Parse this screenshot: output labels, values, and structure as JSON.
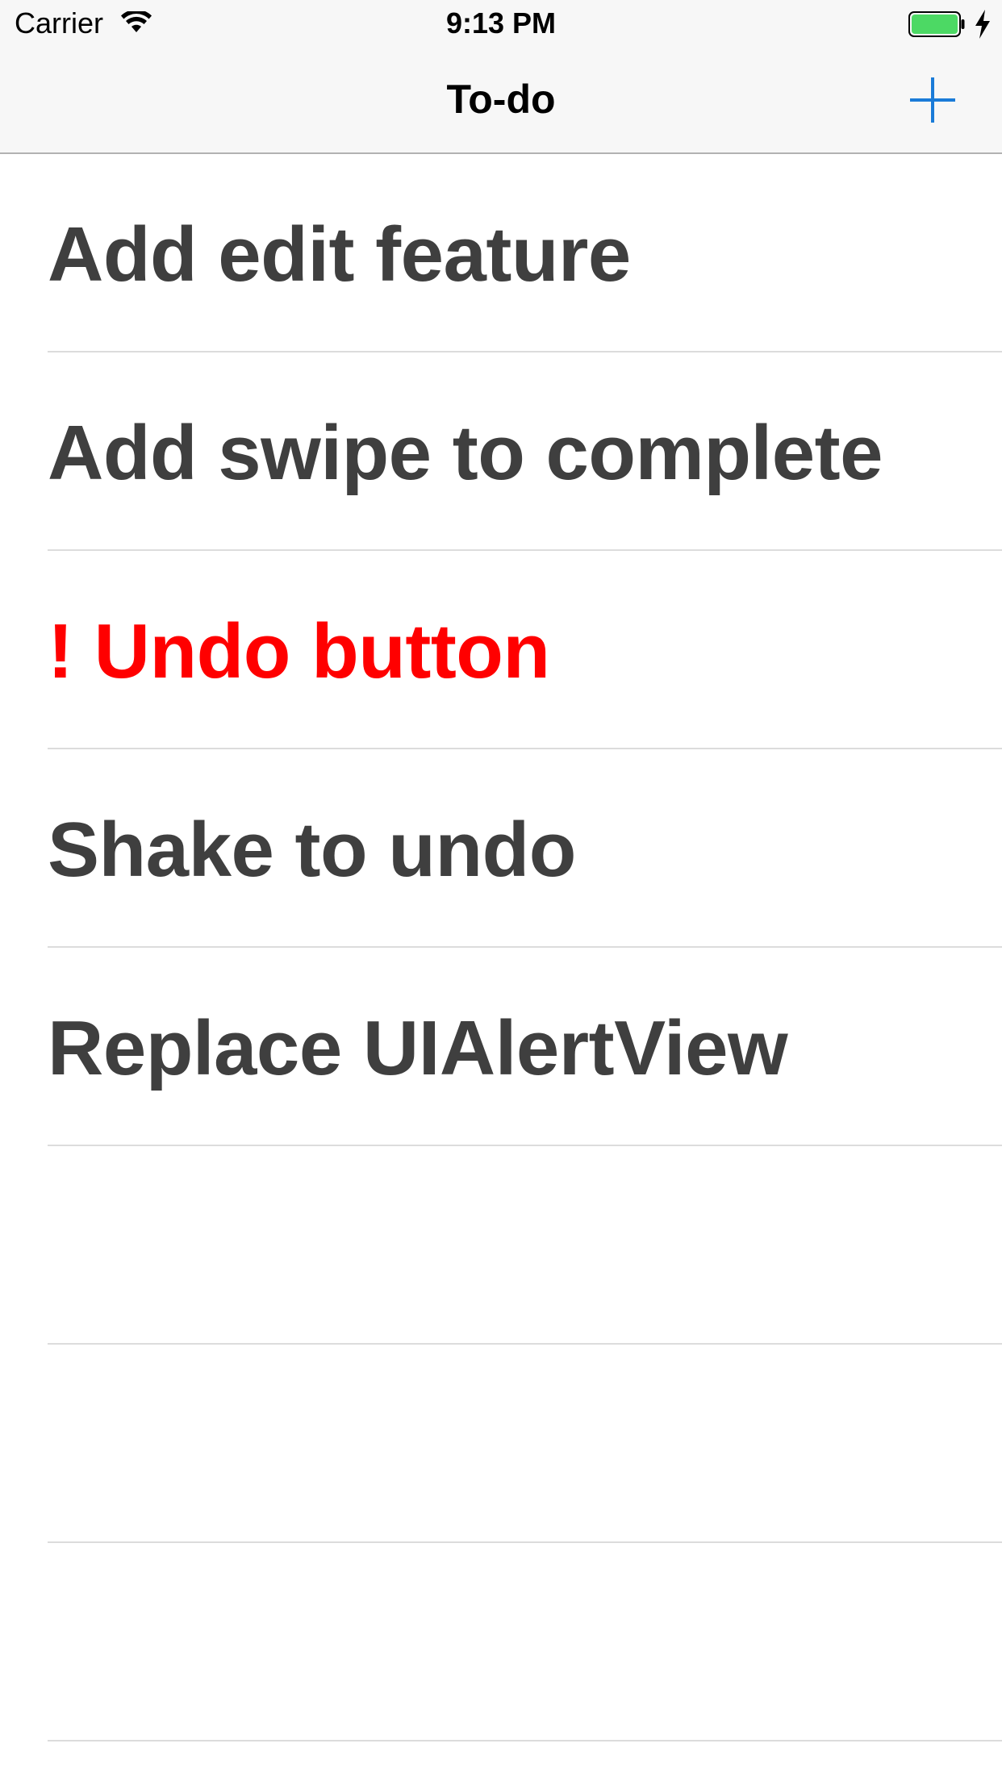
{
  "status_bar": {
    "carrier": "Carrier",
    "time": "9:13 PM",
    "battery_color": "#4cd964",
    "wifi_icon": "wifi-icon",
    "charging_icon": "charging-bolt-icon"
  },
  "nav": {
    "title": "To-do",
    "add_icon": "plus-icon",
    "accent_color": "#1a7bd8"
  },
  "todos": [
    {
      "label": "Add edit feature",
      "urgent": false
    },
    {
      "label": "Add swipe to complete",
      "urgent": false
    },
    {
      "label": "! Undo button",
      "urgent": true
    },
    {
      "label": "Shake to undo",
      "urgent": false
    },
    {
      "label": "Replace UIAlertView",
      "urgent": false
    },
    {
      "label": "",
      "urgent": false
    },
    {
      "label": "",
      "urgent": false
    },
    {
      "label": "",
      "urgent": false
    }
  ],
  "colors": {
    "text": "#3f3f3f",
    "urgent": "#ff0000",
    "separator": "#dcdcdc"
  }
}
